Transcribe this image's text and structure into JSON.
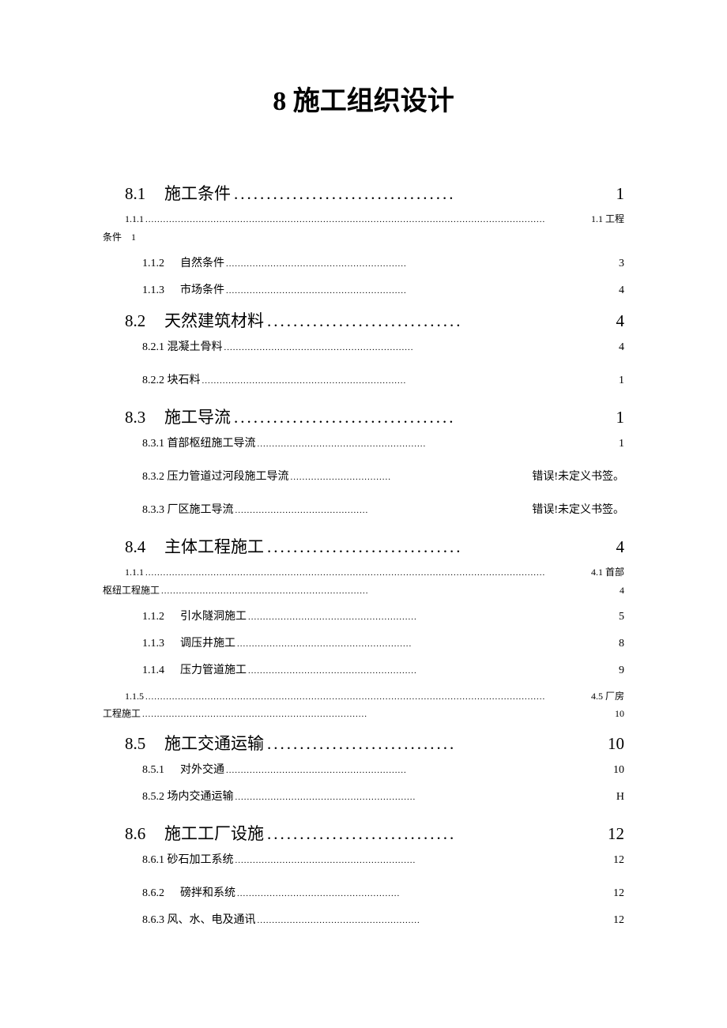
{
  "title": "8 施工组织设计",
  "toc": {
    "s81": {
      "num": "8.1",
      "label": "施工条件",
      "page": "1"
    },
    "s111a": {
      "num": "1.1.1",
      "suffix": "1.1 工程"
    },
    "s111a_cont": {
      "label": "条件",
      "page": "1"
    },
    "s112a": {
      "num": "1.1.2",
      "label": "自然条件",
      "page": "3"
    },
    "s113a": {
      "num": "1.1.3",
      "label": "市场条件",
      "page": "4"
    },
    "s82": {
      "num": "8.2",
      "label": "天然建筑材料",
      "page": "4"
    },
    "s821": {
      "num": "8.2.1 混凝土骨料",
      "label": "",
      "page": "4"
    },
    "s822": {
      "num": "8.2.2 块石料",
      "label": "",
      "page": "1"
    },
    "s83": {
      "num": "8.3",
      "label": "施工导流",
      "page": "1"
    },
    "s831": {
      "num": "8.3.1 首部枢纽施工导流",
      "label": "",
      "page": "1"
    },
    "s832": {
      "num": "8.3.2 压力管道过河段施工导流",
      "label": "",
      "page": "错误!未定义书签。"
    },
    "s833": {
      "num": "8.3.3 厂区施工导流",
      "label": "",
      "page": "错误!未定义书签。"
    },
    "s84": {
      "num": "8.4",
      "label": "主体工程施工",
      "page": "4"
    },
    "s111b": {
      "num": "1.1.1",
      "suffix": "4.1 首部"
    },
    "s111b_cont": {
      "label": "枢纽工程施工",
      "page": "4"
    },
    "s112b": {
      "num": "1.1.2",
      "label": "引水隧洞施工",
      "page": "5"
    },
    "s113b": {
      "num": "1.1.3",
      "label": "调压井施工",
      "page": "8"
    },
    "s114": {
      "num": "1.1.4",
      "label": "压力管道施工",
      "page": "9"
    },
    "s115": {
      "num": "1.1.5",
      "suffix": "4.5 厂房"
    },
    "s115_cont": {
      "label": "工程施工",
      "page": "10"
    },
    "s85": {
      "num": "8.5",
      "label": "施工交通运输",
      "page": "10"
    },
    "s851": {
      "num": "8.5.1",
      "label": "对外交通",
      "page": "10"
    },
    "s852": {
      "num": "8.5.2 场内交通运输",
      "label": "",
      "page": "H"
    },
    "s86": {
      "num": "8.6",
      "label": "施工工厂设施",
      "page": "12"
    },
    "s861": {
      "num": "8.6.1 砂石加工系统",
      "label": "",
      "page": "12"
    },
    "s862": {
      "num": "8.6.2",
      "label": "磅拌和系统",
      "page": "12"
    },
    "s863": {
      "num": "8.6.3 风、水、电及通讯",
      "label": "",
      "page": "12"
    }
  }
}
